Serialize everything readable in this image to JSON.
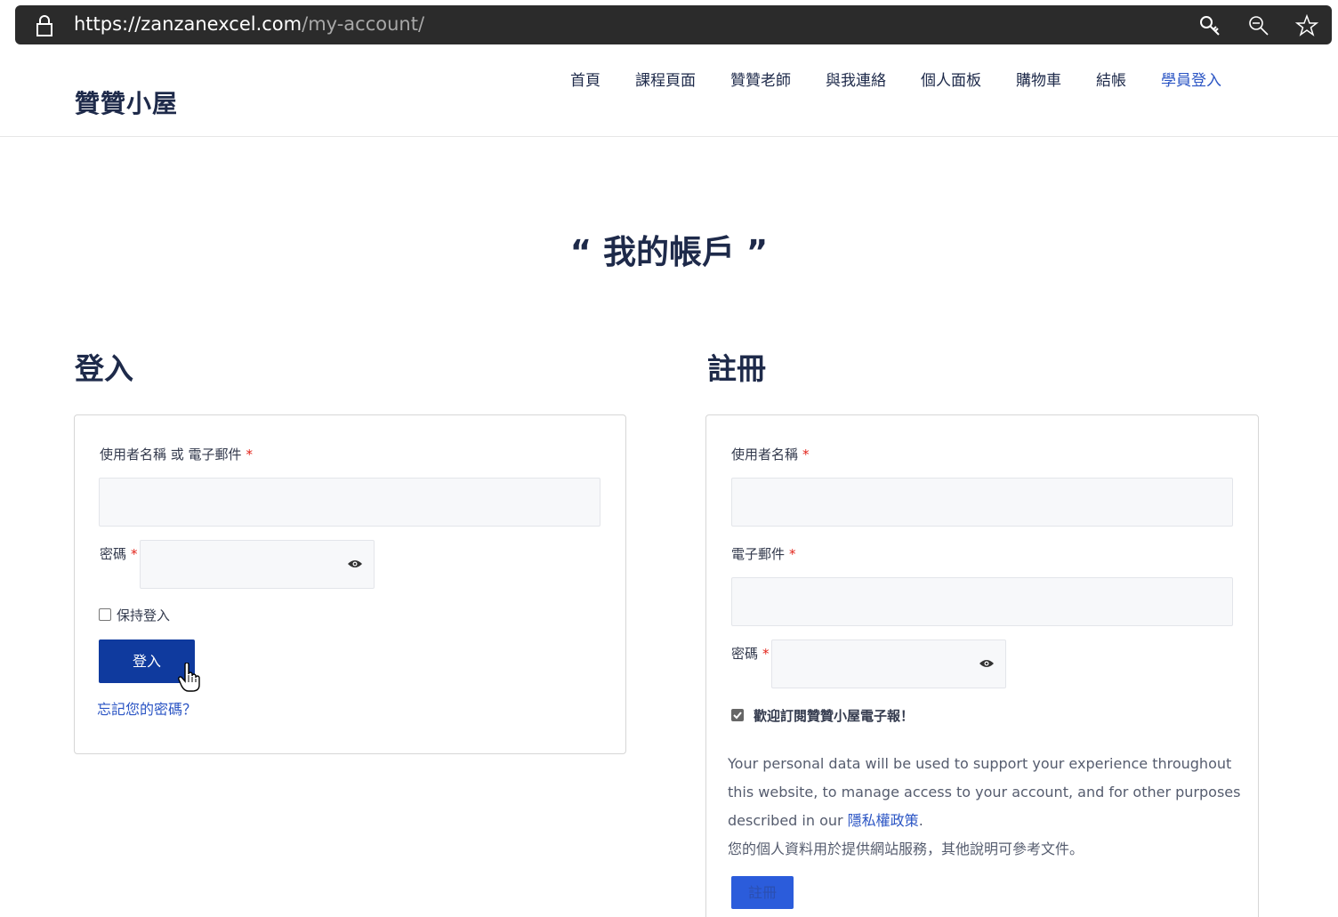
{
  "browser": {
    "url_host": "https://zanzanexcel.com",
    "url_path": "/my-account/"
  },
  "header": {
    "site_title": "贊贊小屋",
    "nav": [
      {
        "label": "首頁"
      },
      {
        "label": "課程頁面"
      },
      {
        "label": "贊贊老師"
      },
      {
        "label": "與我連絡"
      },
      {
        "label": "個人面板"
      },
      {
        "label": "購物車"
      },
      {
        "label": "結帳"
      },
      {
        "label": "學員登入",
        "active": true
      }
    ]
  },
  "page_title": "“ 我的帳戶 ”",
  "login": {
    "heading": "登入",
    "username_label": "使用者名稱 或 電子郵件",
    "password_label": "密碼",
    "required_mark": "*",
    "remember_label": "保持登入",
    "remember_checked": false,
    "submit_label": "登入",
    "forgot_link": "忘記您的密碼？"
  },
  "register": {
    "heading": "註冊",
    "username_label": "使用者名稱",
    "email_label": "電子郵件",
    "password_label": "密碼",
    "required_mark": "*",
    "newsletter_label": "歡迎訂閱贊贊小屋電子報！",
    "newsletter_checked": true,
    "privacy_text": "Your personal data will be used to support your experience throughout this website, to manage access to your account, and for other purposes described in our ",
    "privacy_link": "隱私權政策",
    "privacy_end": ".",
    "privacy_cn": "您的個人資料用於提供網站服務，其他說明可參考文件。",
    "submit_label": "註冊"
  },
  "colors": {
    "accent": "#2b55c4",
    "button": "#0f3a9e",
    "required": "#e2231a",
    "text": "#1e2a4a"
  }
}
